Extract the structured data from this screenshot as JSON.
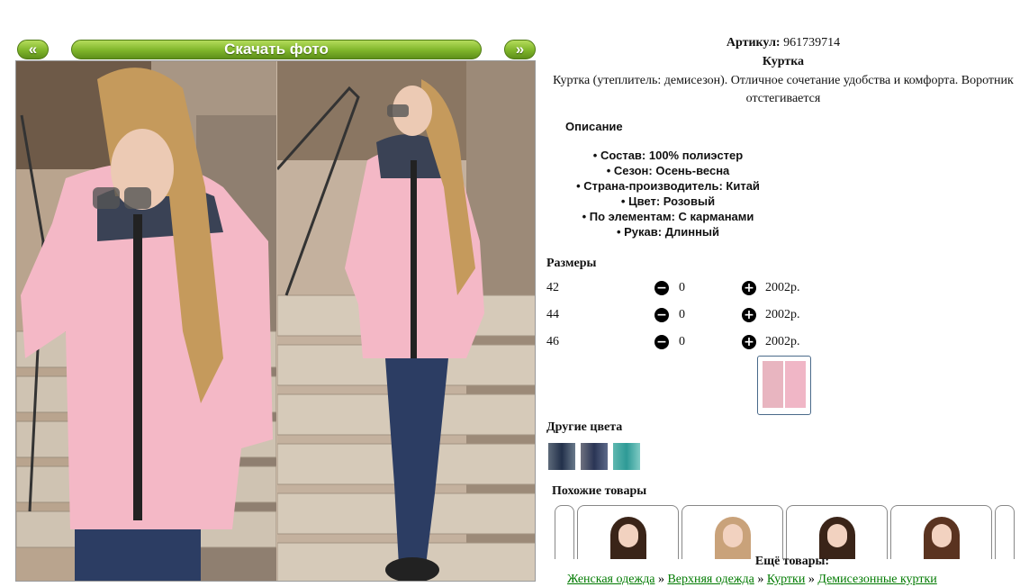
{
  "nav": {
    "prev_label": "«",
    "download_label": "Скачать фото",
    "next_label": "»"
  },
  "product": {
    "article_label": "Артикул:",
    "article_value": "961739714",
    "title": "Куртка",
    "description": "Куртка (утеплитель: демисезон). Отличное сочетание удобства и комфорта. Воротник отстегивается"
  },
  "specs": {
    "heading": "Описание",
    "items": [
      "Состав: 100% полиэстер",
      "Сезон: Осень-весна",
      "Страна-производитель: Китай",
      "Цвет: Розовый",
      "По элементам: С карманами",
      "Рукав: Длинный"
    ]
  },
  "sizes": {
    "heading": "Размеры",
    "rows": [
      {
        "size": "42",
        "qty": "0",
        "price": "2002р."
      },
      {
        "size": "44",
        "qty": "0",
        "price": "2002р."
      },
      {
        "size": "46",
        "qty": "0",
        "price": "2002р."
      }
    ]
  },
  "other_colors": {
    "heading": "Другие цвета"
  },
  "similar": {
    "heading": "Похожие товары"
  },
  "more": {
    "heading": "Ещё товары:",
    "breadcrumb": [
      "Женская одежда",
      "Верхняя одежда",
      "Куртки",
      "Демисезонные куртки"
    ],
    "separator": "»"
  },
  "colors": {
    "accent_green": "#7fb52a",
    "link_green": "#007a00",
    "jacket_pink": "#f4b8c6"
  }
}
